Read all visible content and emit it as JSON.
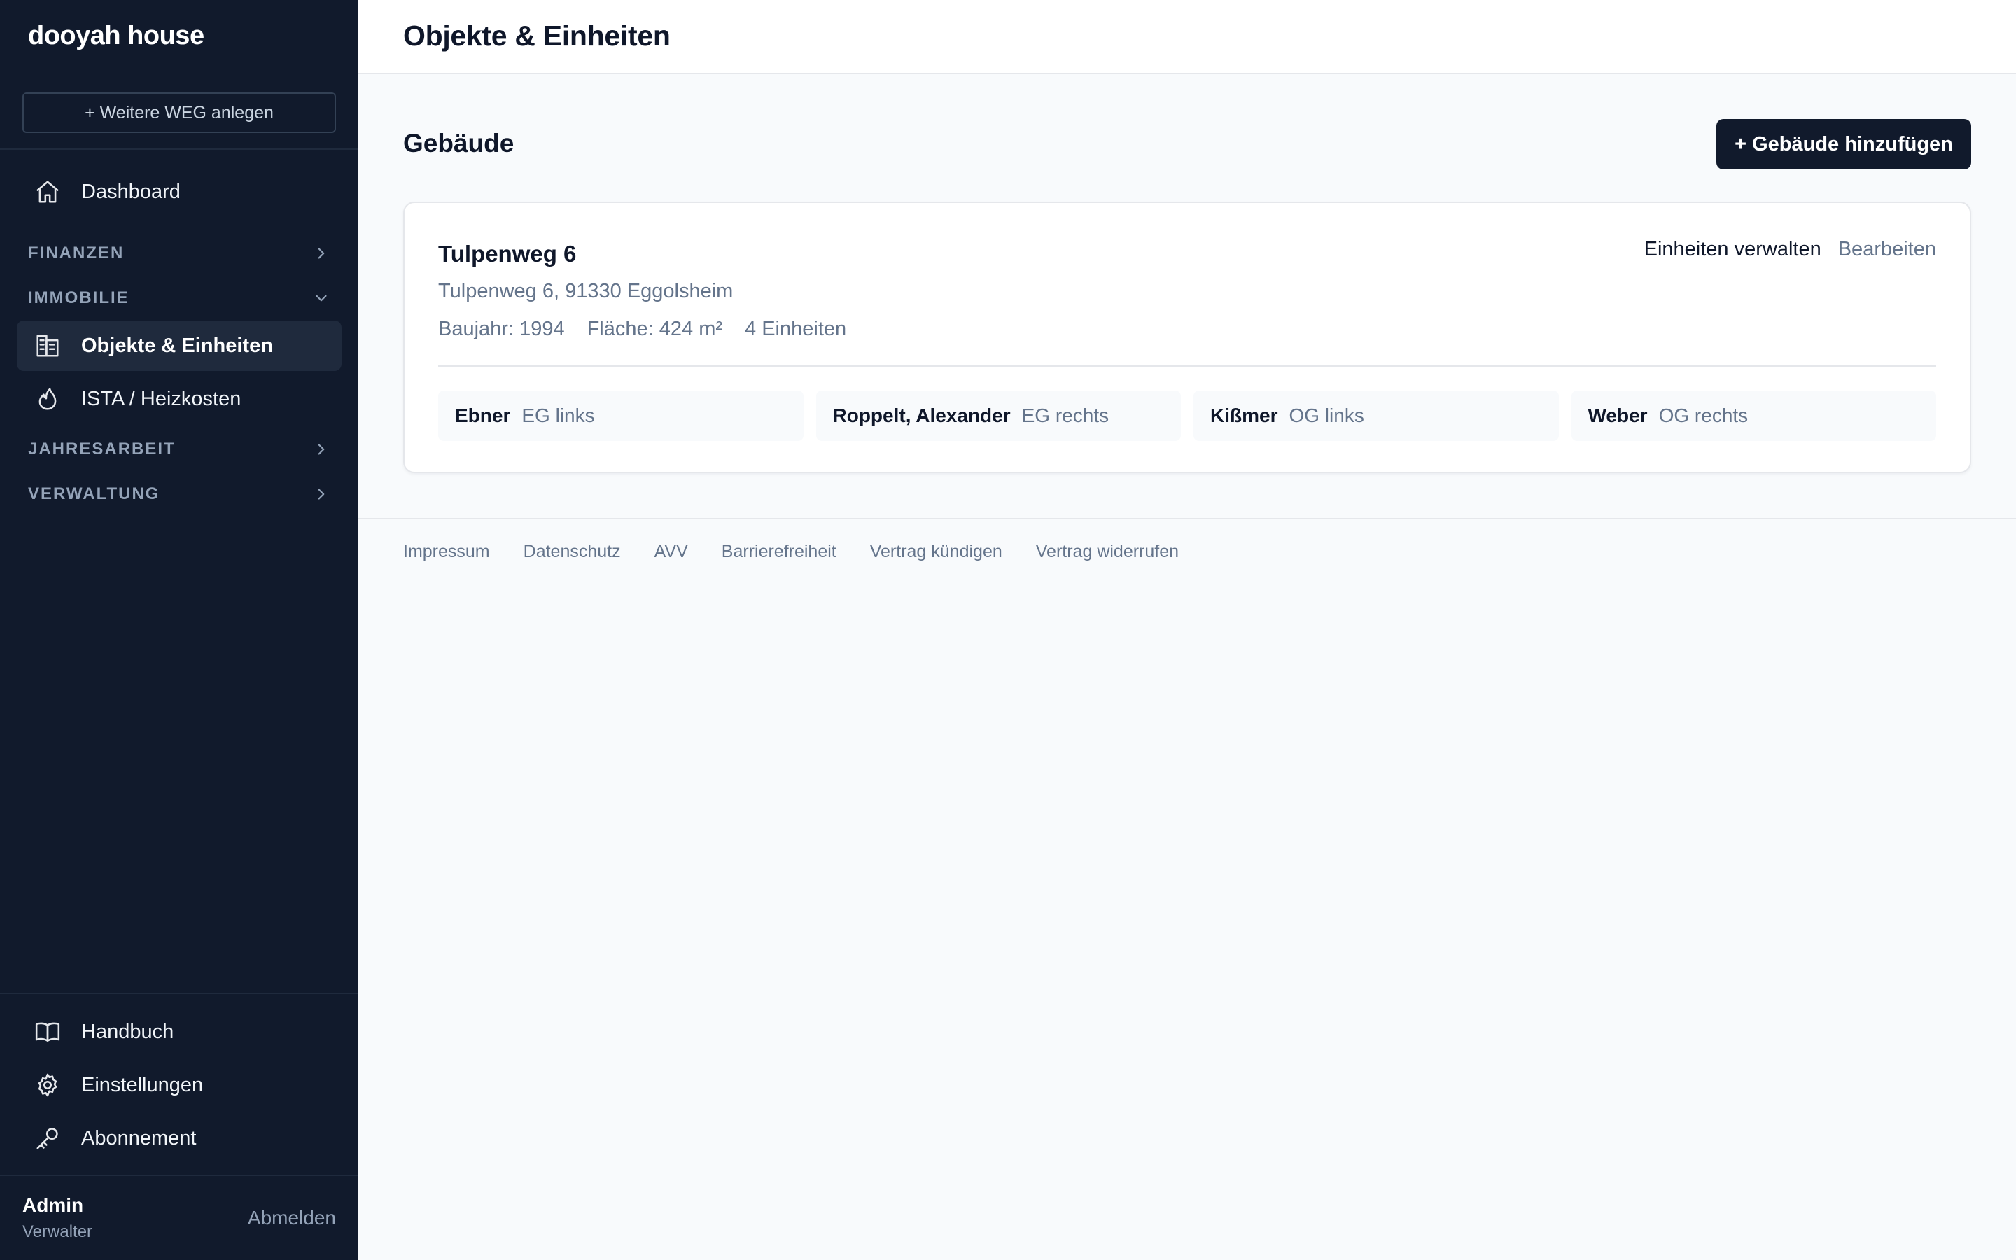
{
  "sidebar": {
    "brand": "dooyah house",
    "add_weg_label": "+ Weitere WEG anlegen",
    "dashboard": "Dashboard",
    "sections": {
      "finanzen": "FINANZEN",
      "immobilie": "IMMOBILIE",
      "jahresarbeit": "JAHRESARBEIT",
      "verwaltung": "VERWALTUNG"
    },
    "immobilie_items": [
      {
        "label": "Objekte & Einheiten",
        "icon": "building-icon",
        "active": true
      },
      {
        "label": "ISTA / Heizkosten",
        "icon": "flame-icon",
        "active": false
      }
    ],
    "bottom_items": [
      {
        "label": "Handbuch",
        "icon": "book-icon"
      },
      {
        "label": "Einstellungen",
        "icon": "gear-icon"
      },
      {
        "label": "Abonnement",
        "icon": "key-icon"
      }
    ],
    "user": {
      "name": "Admin",
      "role": "Verwalter",
      "logout": "Abmelden"
    }
  },
  "header": {
    "title": "Objekte & Einheiten"
  },
  "main": {
    "section_title": "Gebäude",
    "add_button": "+ Gebäude hinzufügen",
    "building": {
      "name": "Tulpenweg 6",
      "address": "Tulpenweg 6, 91330 Eggolsheim",
      "baujahr": "Baujahr: 1994",
      "flaeche": "Fläche: 424 m²",
      "einheiten": "4 Einheiten",
      "manage_label": "Einheiten verwalten",
      "edit_label": "Bearbeiten",
      "units": [
        {
          "owner": "Ebner",
          "position": "EG links"
        },
        {
          "owner": "Roppelt, Alexander",
          "position": "EG rechts"
        },
        {
          "owner": "Kißmer",
          "position": "OG links"
        },
        {
          "owner": "Weber",
          "position": "OG rechts"
        }
      ]
    }
  },
  "footer": {
    "links": [
      "Impressum",
      "Datenschutz",
      "AVV",
      "Barrierefreiheit",
      "Vertrag kündigen",
      "Vertrag widerrufen"
    ]
  }
}
